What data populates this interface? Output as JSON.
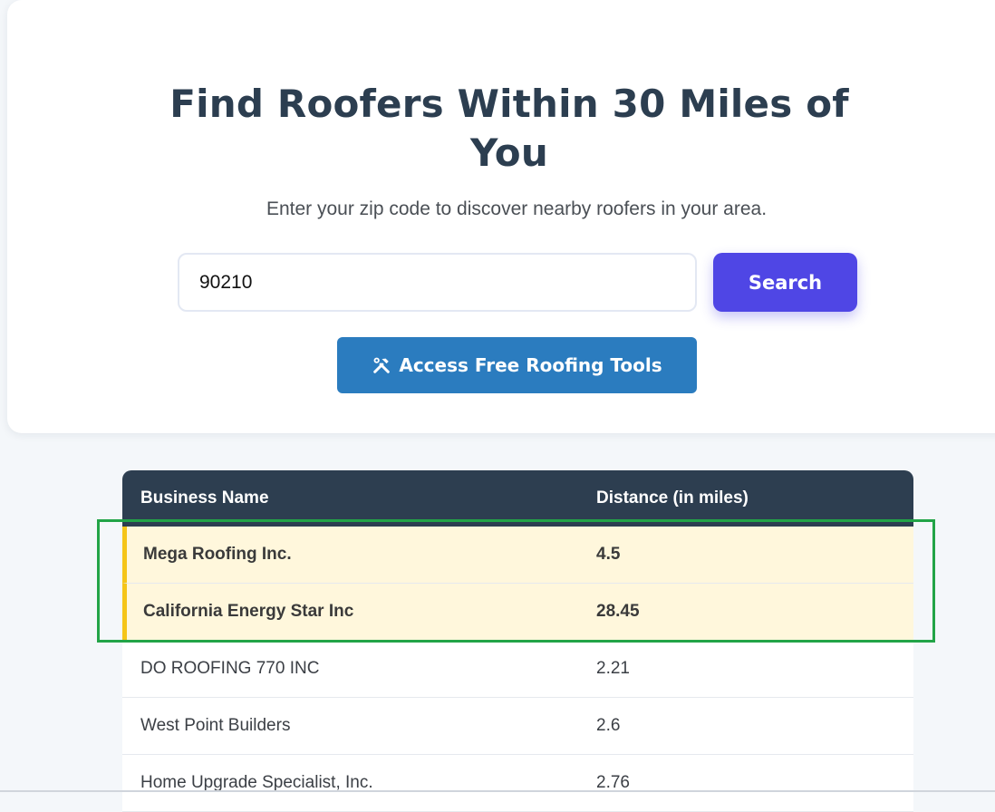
{
  "hero": {
    "title": "Find Roofers Within 30 Miles of You",
    "subtitle": "Enter your zip code to discover nearby roofers in your area.",
    "zip_value": "90210",
    "search_label": "Search",
    "tools_label": "Access Free Roofing Tools",
    "tools_icon": "tools-icon"
  },
  "table": {
    "headers": {
      "name": "Business Name",
      "distance": "Distance (in miles)"
    },
    "featured_rows": [
      {
        "name": "Mega Roofing Inc.",
        "distance": "4.5"
      },
      {
        "name": "California Energy Star Inc",
        "distance": "28.45"
      }
    ],
    "rows": [
      {
        "name": "DO ROOFING 770 INC",
        "distance": "2.21"
      },
      {
        "name": "West Point Builders",
        "distance": "2.6"
      },
      {
        "name": "Home Upgrade Specialist, Inc.",
        "distance": "2.76"
      }
    ]
  },
  "colors": {
    "search_button": "#4f46e5",
    "tools_button": "#2b7cbf",
    "table_header": "#2d3e50",
    "featured_row_bg": "#fff7dc",
    "featured_accent": "#f5c518",
    "highlight_border": "#22a447"
  }
}
